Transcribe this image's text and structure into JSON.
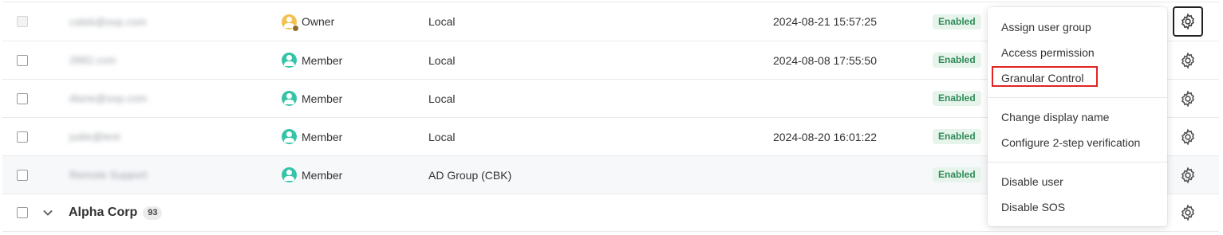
{
  "users": [
    {
      "email": "caleb@oop.com",
      "role": "Owner",
      "role_type": "owner",
      "auth": "Local",
      "last_login": "2024-08-21 15:57:25",
      "status": "Enabled"
    },
    {
      "email": "2882.com",
      "role": "Member",
      "role_type": "member",
      "auth": "Local",
      "last_login": "2024-08-08 17:55:50",
      "status": "Enabled"
    },
    {
      "email": "diane@oop.com",
      "role": "Member",
      "role_type": "member",
      "auth": "Local",
      "last_login": "",
      "status": "Enabled"
    },
    {
      "email": "judie@test",
      "role": "Member",
      "role_type": "member",
      "auth": "Local",
      "last_login": "2024-08-20 16:01:22",
      "status": "Enabled"
    },
    {
      "email": "Remote Support",
      "role": "Member",
      "role_type": "member",
      "auth": "AD Group (CBK)",
      "last_login": "",
      "status": "Enabled"
    }
  ],
  "group": {
    "name": "Alpha Corp",
    "count": "93"
  },
  "menu": {
    "items": [
      {
        "label": "Assign user group"
      },
      {
        "label": "Access permission"
      },
      {
        "label": "Granular Control"
      },
      {
        "label": "Change display name"
      },
      {
        "label": "Configure 2-step verification"
      },
      {
        "label": "Disable user"
      },
      {
        "label": "Disable SOS"
      }
    ]
  },
  "colors": {
    "member_icon": "#35c4a7",
    "owner_icon": "#f2c14e",
    "enabled_badge_bg": "#e6f4ec",
    "enabled_badge_text": "#2f8a57",
    "highlight_border": "#e02424"
  }
}
